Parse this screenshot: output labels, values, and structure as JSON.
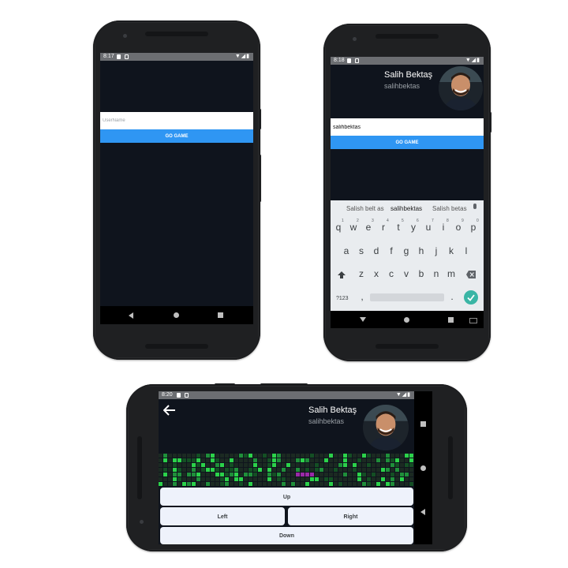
{
  "phone1": {
    "status_time": "8:17",
    "username_placeholder": "UserName",
    "go_game_label": "GO GAME"
  },
  "phone2": {
    "status_time": "8:18",
    "profile_name": "Salih Bektaş",
    "profile_username": "salihbektas",
    "username_value": "salihbektas",
    "go_game_label": "GO GAME",
    "keyboard": {
      "suggestions": [
        "Salish belt as",
        "salihbektas",
        "Salish betas"
      ],
      "row1": [
        "q",
        "w",
        "e",
        "r",
        "t",
        "y",
        "u",
        "i",
        "o",
        "p"
      ],
      "row1_numbers": [
        "1",
        "2",
        "3",
        "4",
        "5",
        "6",
        "7",
        "8",
        "9",
        "0"
      ],
      "row2": [
        "a",
        "s",
        "d",
        "f",
        "g",
        "h",
        "j",
        "k",
        "l"
      ],
      "row3": [
        "z",
        "x",
        "c",
        "v",
        "b",
        "n",
        "m"
      ],
      "symbols_label": "?123",
      "comma": ",",
      "period": ".",
      "accent_color": "#3ab5a5"
    }
  },
  "phone3": {
    "status_time": "8:20",
    "profile_name": "Salih Bektaş",
    "profile_username": "salihbektas",
    "controls": {
      "up": "Up",
      "left": "Left",
      "right": "Right",
      "down": "Down"
    },
    "grid_colors": {
      "bright": "#2bd24a",
      "medium": "#1f8f3a",
      "dim": "#144f24",
      "empty": "#1b2a22",
      "player": "#9a2aa8"
    }
  },
  "icons": {
    "back_arrow": "back-arrow-icon",
    "mic": "mic-icon",
    "shift": "shift-icon",
    "backspace": "backspace-icon",
    "enter": "check-enter-icon"
  }
}
